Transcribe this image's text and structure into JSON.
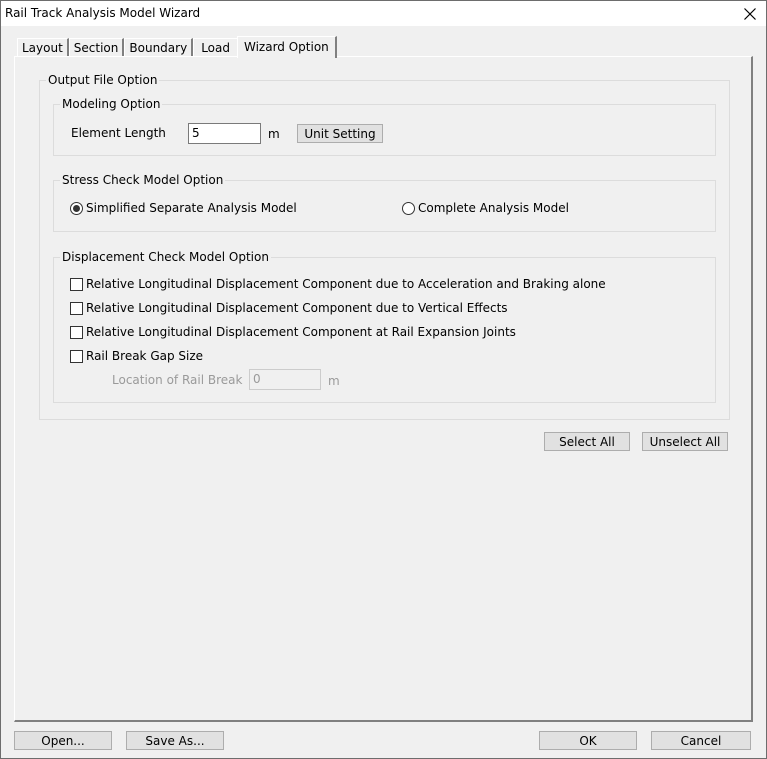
{
  "window": {
    "title": "Rail Track Analysis Model Wizard",
    "close_icon": "close-icon"
  },
  "tabs": [
    {
      "label": "Layout",
      "active": false
    },
    {
      "label": "Section",
      "active": false
    },
    {
      "label": "Boundary",
      "active": false
    },
    {
      "label": "Load",
      "active": false
    },
    {
      "label": "Wizard Option",
      "active": true
    }
  ],
  "output_file_option": {
    "title": "Output File Option",
    "modeling_option": {
      "title": "Modeling Option",
      "element_length_label": "Element Length",
      "element_length_value": "5",
      "unit": "m",
      "unit_setting_label": "Unit Setting"
    },
    "stress_check": {
      "title": "Stress Check Model Option",
      "options": [
        {
          "label": "Simplified Separate Analysis Model",
          "checked": true
        },
        {
          "label": "Complete Analysis Model",
          "checked": false
        }
      ]
    },
    "displacement_check": {
      "title": "Displacement Check Model Option",
      "options": [
        {
          "label": "Relative Longitudinal Displacement Component due to Acceleration and Braking alone",
          "checked": false
        },
        {
          "label": "Relative Longitudinal Displacement Component due to Vertical Effects",
          "checked": false
        },
        {
          "label": "Relative Longitudinal Displacement Component at Rail Expansion Joints",
          "checked": false
        },
        {
          "label": "Rail Break Gap Size",
          "checked": false
        }
      ],
      "rail_break_location_label": "Location of Rail Break",
      "rail_break_location_value": "0",
      "rail_break_unit": "m"
    }
  },
  "actions": {
    "select_all": "Select All",
    "unselect_all": "Unselect All"
  },
  "footer": {
    "open": "Open...",
    "save_as": "Save As...",
    "ok": "OK",
    "cancel": "Cancel"
  }
}
